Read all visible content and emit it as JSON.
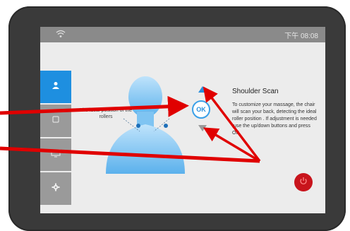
{
  "statusbar": {
    "time": "下午 08:08",
    "wifi_icon": "wifi-icon"
  },
  "sidebar": {
    "items": [
      {
        "name": "user-icon",
        "active": true
      },
      {
        "name": "massage-icon",
        "active": false
      },
      {
        "name": "display-icon",
        "active": false
      },
      {
        "name": "gear-icon",
        "active": false
      }
    ]
  },
  "diagram": {
    "roller_label": "The ideal position of the rollers"
  },
  "controls": {
    "ok_label": "OK"
  },
  "panel": {
    "title": "Shoulder Scan",
    "description": "To customize your massage, the chair will scan your back, detecting the ideal roller position . If adjustment is needed ,use the up/down buttons and press OK."
  },
  "colors": {
    "accent": "#1e8fe0",
    "power": "#c8141c",
    "annotation": "#e00000"
  }
}
